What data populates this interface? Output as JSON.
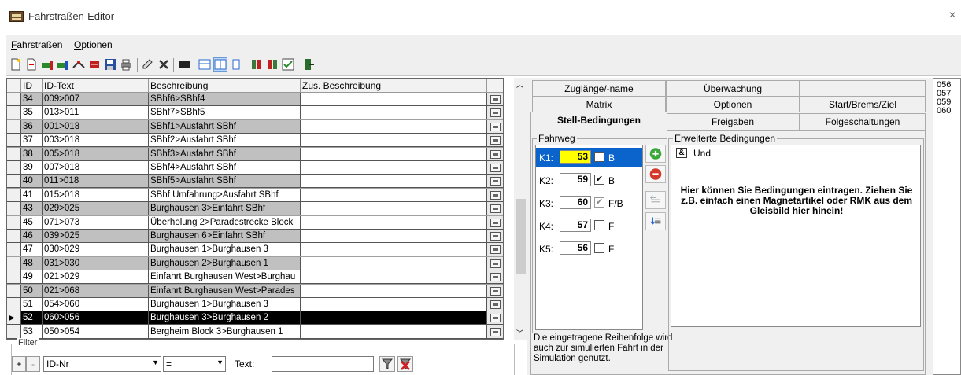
{
  "window": {
    "title": "Fahrstraßen-Editor",
    "close_symbol": "×"
  },
  "menu": [
    {
      "label": "Fahrstraßen",
      "underline": "F"
    },
    {
      "label": "Optionen",
      "underline": "O"
    }
  ],
  "grid": {
    "headers": {
      "id": "ID",
      "id_text": "ID-Text",
      "desc": "Beschreibung",
      "zus": "Zus. Beschreibung"
    },
    "selected_marker": "▶",
    "rows": [
      {
        "id": "34",
        "id_text": "009>007",
        "desc": "SBhf6>SBhf4",
        "shade": "gray"
      },
      {
        "id": "35",
        "id_text": "013>011",
        "desc": "SBhf7>SBhf5",
        "shade": "white"
      },
      {
        "id": "36",
        "id_text": "001>018",
        "desc": "SBhf1>Ausfahrt SBhf",
        "shade": "gray"
      },
      {
        "id": "37",
        "id_text": "003>018",
        "desc": "SBhf2>Ausfahrt SBhf",
        "shade": "white"
      },
      {
        "id": "38",
        "id_text": "005>018",
        "desc": "SBhf3>Ausfahrt SBhf",
        "shade": "gray"
      },
      {
        "id": "39",
        "id_text": "007>018",
        "desc": "SBhf4>Ausfahrt SBhf",
        "shade": "white"
      },
      {
        "id": "40",
        "id_text": "011>018",
        "desc": "SBhf5>Ausfahrt SBhf",
        "shade": "gray"
      },
      {
        "id": "41",
        "id_text": "015>018",
        "desc": "SBhf Umfahrung>Ausfahrt SBhf",
        "shade": "white"
      },
      {
        "id": "43",
        "id_text": "029>025",
        "desc": "Burghausen 3>Einfahrt SBhf",
        "shade": "gray"
      },
      {
        "id": "45",
        "id_text": "071>073",
        "desc": "Überholung 2>Paradestrecke Block",
        "shade": "white"
      },
      {
        "id": "46",
        "id_text": "039>025",
        "desc": "Burghausen 6>Einfahrt SBhf",
        "shade": "gray"
      },
      {
        "id": "47",
        "id_text": "030>029",
        "desc": "Burghausen 1>Burghausen 3",
        "shade": "white"
      },
      {
        "id": "48",
        "id_text": "031>030",
        "desc": "Burghausen 2>Burghausen 1",
        "shade": "gray"
      },
      {
        "id": "49",
        "id_text": "021>029",
        "desc": "Einfahrt Burghausen West>Burghau",
        "shade": "white"
      },
      {
        "id": "50",
        "id_text": "021>068",
        "desc": "Einfahrt Burghausen West>Parades",
        "shade": "gray"
      },
      {
        "id": "51",
        "id_text": "054>060",
        "desc": "Burghausen 1>Burghausen 3",
        "shade": "white"
      },
      {
        "id": "52",
        "id_text": "060>056",
        "desc": "Burghausen 3>Burghausen 2",
        "shade": "sel"
      },
      {
        "id": "53",
        "id_text": "050>054",
        "desc": "Bergheim Block 3>Burghausen 1",
        "shade": "white"
      }
    ]
  },
  "filter": {
    "label": "Filter",
    "plus": "+",
    "minus": "-",
    "field": "ID-Nr",
    "operator": "=",
    "text_label": "Text:",
    "text_value": ""
  },
  "tabs": {
    "row1": [
      "Zuglänge/-name",
      "Überwachung",
      ""
    ],
    "row2": [
      "Matrix",
      "Optionen",
      "Start/Brems/Ziel"
    ],
    "row3": [
      "Stell-Bedingungen",
      "Freigaben",
      "Folgeschaltungen"
    ],
    "active": "Stell-Bedingungen"
  },
  "fahrweg": {
    "label": "Fahrweg",
    "items": [
      {
        "label": "K1:",
        "value": "53",
        "checked": "✔",
        "flag": "B"
      },
      {
        "label": "K2:",
        "value": "59",
        "checked": "✔",
        "flag": "B"
      },
      {
        "label": "K3:",
        "value": "60",
        "checked": "✔",
        "flag": "F/B"
      },
      {
        "label": "K4:",
        "value": "57",
        "checked": "",
        "flag": "F"
      },
      {
        "label": "K5:",
        "value": "56",
        "checked": "",
        "flag": "F"
      }
    ],
    "hint": "Die eingetragene Reihenfolge wird auch zur simulierten Fahrt in der Simulation genutzt."
  },
  "erweitert": {
    "label": "Erweiterte Bedingungen",
    "und_icon_text": "&",
    "und_label": "Und",
    "hint": "Hier können Sie Bedingungen eintragen. Ziehen Sie z.B. einfach einen Magnetartikel oder RMK aus dem Gleisbild hier hinein!"
  },
  "far_list": [
    "056",
    "057",
    "059",
    "060"
  ],
  "colors": {
    "selected_blue": "#0a64cc",
    "highlight_yellow": "#ffff00",
    "row_gray": "#c0c0c0",
    "add_green": "#3aa83a",
    "remove_red": "#d43a2a"
  }
}
